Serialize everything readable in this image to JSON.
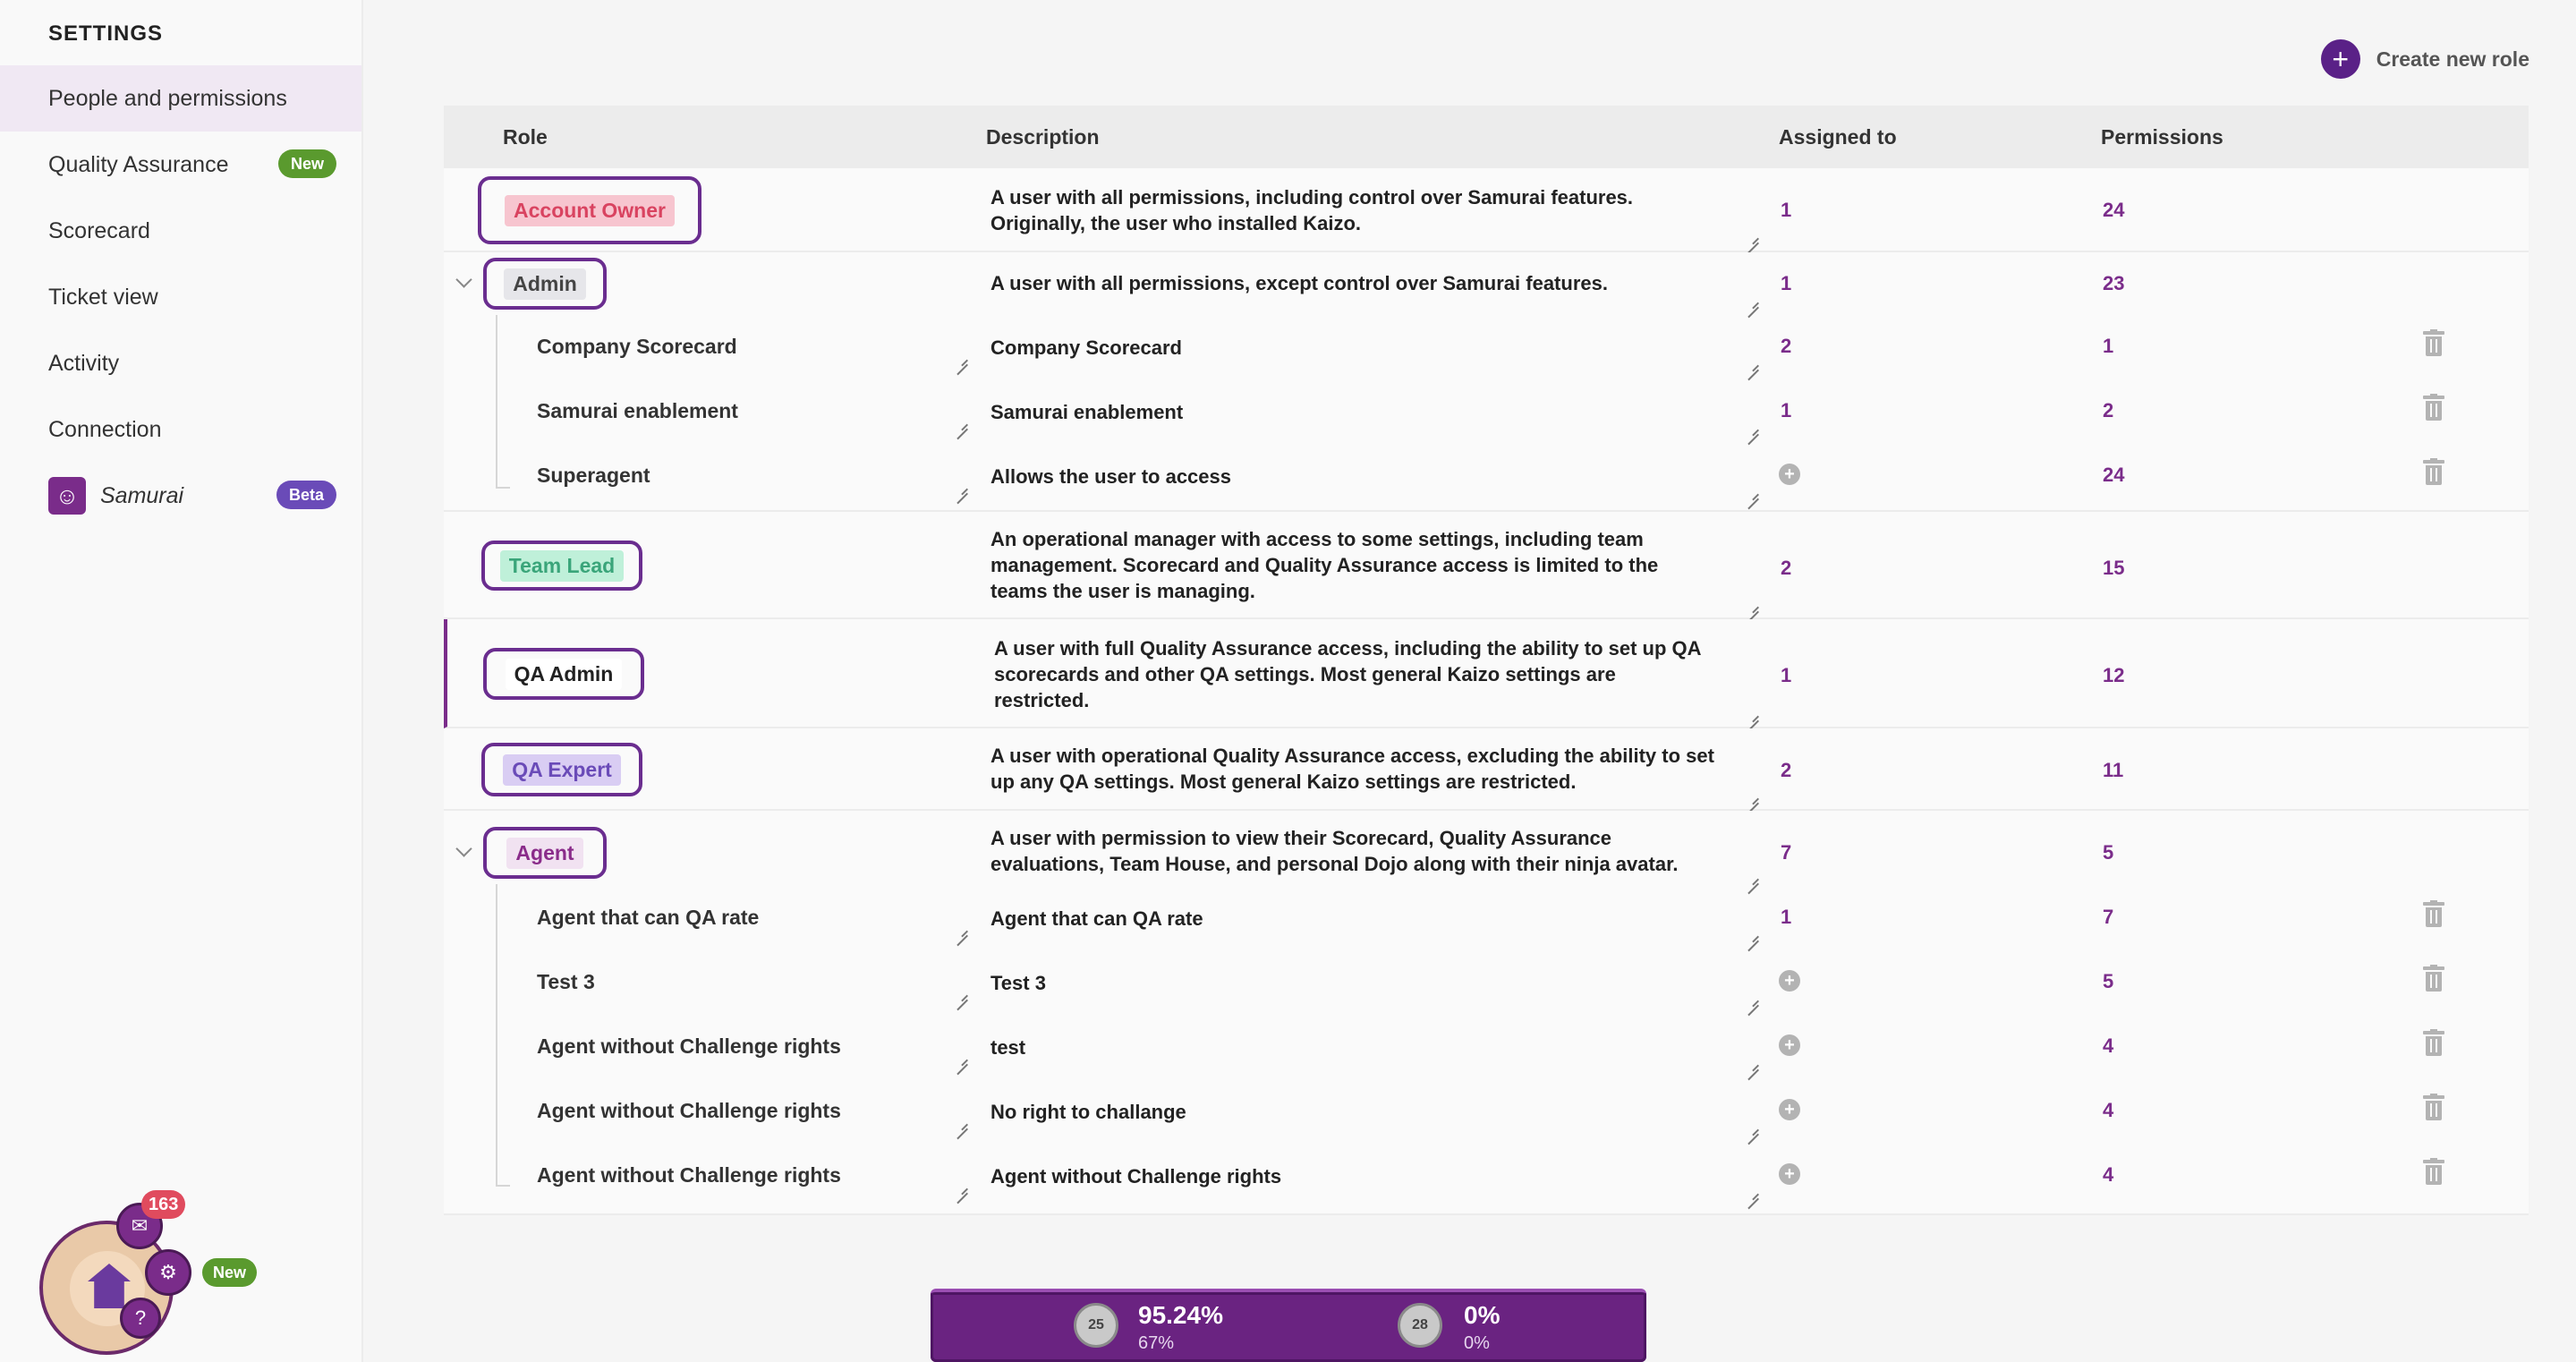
{
  "sidebar": {
    "title": "SETTINGS",
    "items": [
      {
        "label": "People and permissions"
      },
      {
        "label": "Quality Assurance",
        "badge": "New"
      },
      {
        "label": "Scorecard"
      },
      {
        "label": "Ticket view"
      },
      {
        "label": "Activity"
      },
      {
        "label": "Connection"
      },
      {
        "label": "Samurai",
        "badge": "Beta"
      }
    ]
  },
  "actions": {
    "create_role": "Create new role"
  },
  "table": {
    "headers": [
      "Role",
      "Description",
      "Assigned to",
      "Permissions"
    ],
    "roles": {
      "account_owner": {
        "name": "Account Owner",
        "desc1": "A user with all permissions, including control over Samurai features.",
        "desc2": "Originally, the user who installed Kaizo.",
        "assigned": "1",
        "permissions": "24"
      },
      "admin": {
        "name": "Admin",
        "desc": "A user with all permissions, except control over Samurai features.",
        "assigned": "1",
        "permissions": "23",
        "subs": [
          {
            "name": "Company Scorecard",
            "desc": "Company Scorecard",
            "assigned": "2",
            "permissions": "1"
          },
          {
            "name": "Samurai enablement",
            "desc": "Samurai enablement",
            "assigned": "1",
            "permissions": "2"
          },
          {
            "name": "Superagent",
            "desc": "Allows the user to access",
            "assigned": "",
            "permissions": "24"
          }
        ]
      },
      "team_lead": {
        "name": "Team Lead",
        "desc1": "An operational manager with access to some settings, including team",
        "desc2": "management. Scorecard and Quality Assurance access is limited to the",
        "desc3": "teams the user is managing.",
        "assigned": "2",
        "permissions": "15"
      },
      "qa_admin": {
        "name": "QA Admin",
        "desc1": "A user with full Quality Assurance access, including the ability to set up QA",
        "desc2": "scorecards and other QA settings. Most general Kaizo settings are",
        "desc3": "restricted.",
        "assigned": "1",
        "permissions": "12"
      },
      "qa_expert": {
        "name": "QA Expert",
        "desc1": "A user with operational Quality Assurance access, excluding the ability to set",
        "desc2": "up any QA settings. Most general Kaizo settings are restricted.",
        "assigned": "2",
        "permissions": "11"
      },
      "agent": {
        "name": "Agent",
        "desc1": "A user with permission to view their Scorecard, Quality Assurance",
        "desc2": "evaluations, Team House, and personal Dojo along with their ninja avatar.",
        "assigned": "7",
        "permissions": "5",
        "subs": [
          {
            "name": "Agent that can QA rate",
            "desc": "Agent that can QA rate",
            "assigned": "1",
            "permissions": "7"
          },
          {
            "name": "Test 3",
            "desc": "Test 3",
            "assigned": "",
            "permissions": "5"
          },
          {
            "name": "Agent without Challenge rights",
            "desc": "test",
            "assigned": "",
            "permissions": "4"
          },
          {
            "name": "Agent without Challenge rights",
            "desc": "No right to challange",
            "assigned": "",
            "permissions": "4"
          },
          {
            "name": "Agent without Challenge rights",
            "desc": "Agent without Challenge rights",
            "assigned": "",
            "permissions": "4"
          }
        ]
      }
    }
  },
  "dock": {
    "notifications": "163",
    "new_badge": "New"
  },
  "scorebar": {
    "left": {
      "rank": "25",
      "pct": "95.24%",
      "sub": "67%"
    },
    "right": {
      "rank": "28",
      "pct": "0%",
      "sub": "0%"
    }
  },
  "colors": {
    "accent": "#5a2187",
    "number": "#7a2c8a",
    "account_owner_bg": "#f7c5cf",
    "account_owner_fg": "#d94360",
    "admin_bg": "#e6e6ea",
    "team_lead_bg": "#bff0d9",
    "team_lead_fg": "#3aa57a",
    "qa_expert_bg": "#d9cdf3",
    "qa_expert_fg": "#6a4bb8",
    "agent_bg": "#f1e2f1",
    "agent_fg": "#8a2c8a"
  }
}
